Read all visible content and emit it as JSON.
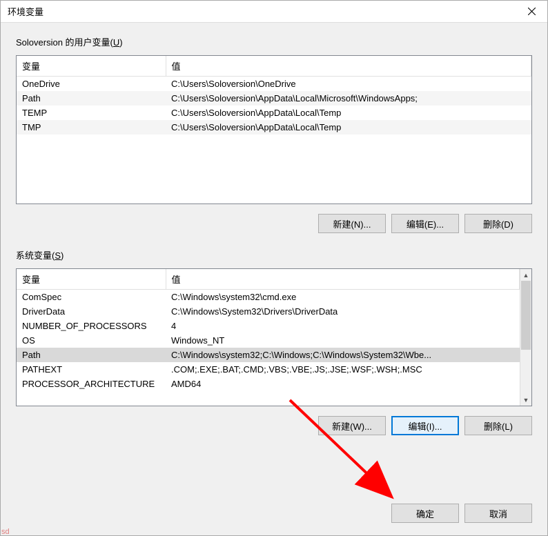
{
  "window": {
    "title": "环境变量"
  },
  "user_section": {
    "label_prefix": "Soloversion 的用户变量(",
    "label_key": "U",
    "label_suffix": ")",
    "headers": {
      "var": "变量",
      "val": "值"
    },
    "rows": [
      {
        "var": "OneDrive",
        "val": "C:\\Users\\Soloversion\\OneDrive"
      },
      {
        "var": "Path",
        "val": "C:\\Users\\Soloversion\\AppData\\Local\\Microsoft\\WindowsApps;"
      },
      {
        "var": "TEMP",
        "val": "C:\\Users\\Soloversion\\AppData\\Local\\Temp"
      },
      {
        "var": "TMP",
        "val": "C:\\Users\\Soloversion\\AppData\\Local\\Temp"
      }
    ],
    "buttons": {
      "new": "新建(N)...",
      "edit": "编辑(E)...",
      "delete": "删除(D)"
    }
  },
  "system_section": {
    "label_prefix": "系统变量(",
    "label_key": "S",
    "label_suffix": ")",
    "headers": {
      "var": "变量",
      "val": "值"
    },
    "rows": [
      {
        "var": "ComSpec",
        "val": "C:\\Windows\\system32\\cmd.exe"
      },
      {
        "var": "DriverData",
        "val": "C:\\Windows\\System32\\Drivers\\DriverData"
      },
      {
        "var": "NUMBER_OF_PROCESSORS",
        "val": "4"
      },
      {
        "var": "OS",
        "val": "Windows_NT"
      },
      {
        "var": "Path",
        "val": "C:\\Windows\\system32;C:\\Windows;C:\\Windows\\System32\\Wbe..."
      },
      {
        "var": "PATHEXT",
        "val": ".COM;.EXE;.BAT;.CMD;.VBS;.VBE;.JS;.JSE;.WSF;.WSH;.MSC"
      },
      {
        "var": "PROCESSOR_ARCHITECTURE",
        "val": "AMD64"
      }
    ],
    "buttons": {
      "new": "新建(W)...",
      "edit": "编辑(I)...",
      "delete": "删除(L)"
    },
    "selected_index": 4
  },
  "dialog_buttons": {
    "ok": "确定",
    "cancel": "取消"
  },
  "watermark": "sd"
}
